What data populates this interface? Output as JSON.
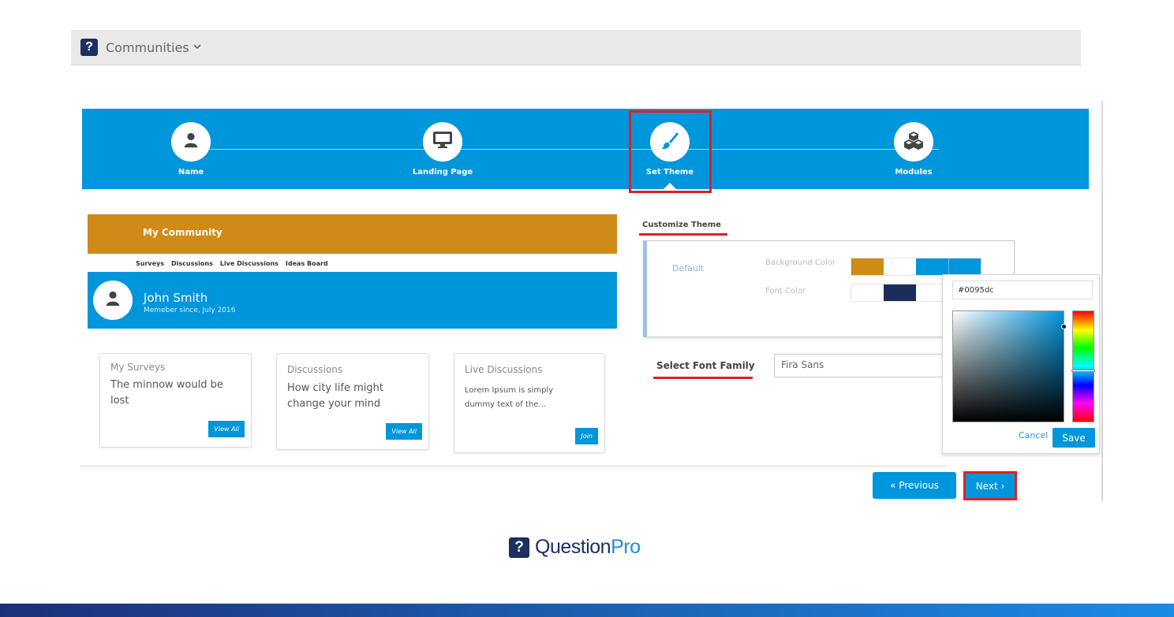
{
  "topbar": {
    "logo_glyph": "?",
    "title": "Communities",
    "chevron": "⌄"
  },
  "steps": [
    {
      "label": "Name",
      "icon": "user-icon",
      "active": false
    },
    {
      "label": "Landing Page",
      "icon": "monitor-icon",
      "active": false
    },
    {
      "label": "Set Theme",
      "icon": "paintbrush-icon",
      "active": true
    },
    {
      "label": "Modules",
      "icon": "cubes-icon",
      "active": false
    }
  ],
  "preview": {
    "community_title": "My Community",
    "nav": [
      "Surveys",
      "Discussions",
      "Live Discussions",
      "Ideas Board"
    ],
    "profile_name": "John Smith",
    "profile_since": "Memeber since, July 2016",
    "cards": [
      {
        "title": "My Surveys",
        "body": "The minnow would be lost",
        "button": "View All"
      },
      {
        "title": "Discussions",
        "body": "How city life might change your mind",
        "button": "View All"
      },
      {
        "title": "Live Discussions",
        "body": "Lorem Ipsum is simply dummy text of the...",
        "button": "Join"
      }
    ]
  },
  "customize": {
    "label": "Customize Theme",
    "default_label": "Default",
    "bg_label": "Background Color",
    "font_label": "Font Color",
    "bg_swatches": [
      "#d08a17",
      "#ffffff",
      "#0096dc",
      "#0096dc"
    ],
    "font_swatches": [
      "#ffffff",
      "#1c2d5b",
      "#ffffff"
    ]
  },
  "picker": {
    "hex": "#0095dc",
    "cancel": "Cancel",
    "save": "Save"
  },
  "font_family": {
    "label": "Select Font Family",
    "value": "Fira Sans"
  },
  "nav_buttons": {
    "previous": "« Previous",
    "next": "Next ›"
  },
  "brand": {
    "glyph": "?",
    "question": "Question",
    "pro": "Pro"
  },
  "colors": {
    "primary": "#0096dc",
    "community_header": "#d08a17",
    "highlight": "#e0201f",
    "brand_navy": "#1c2f63"
  }
}
